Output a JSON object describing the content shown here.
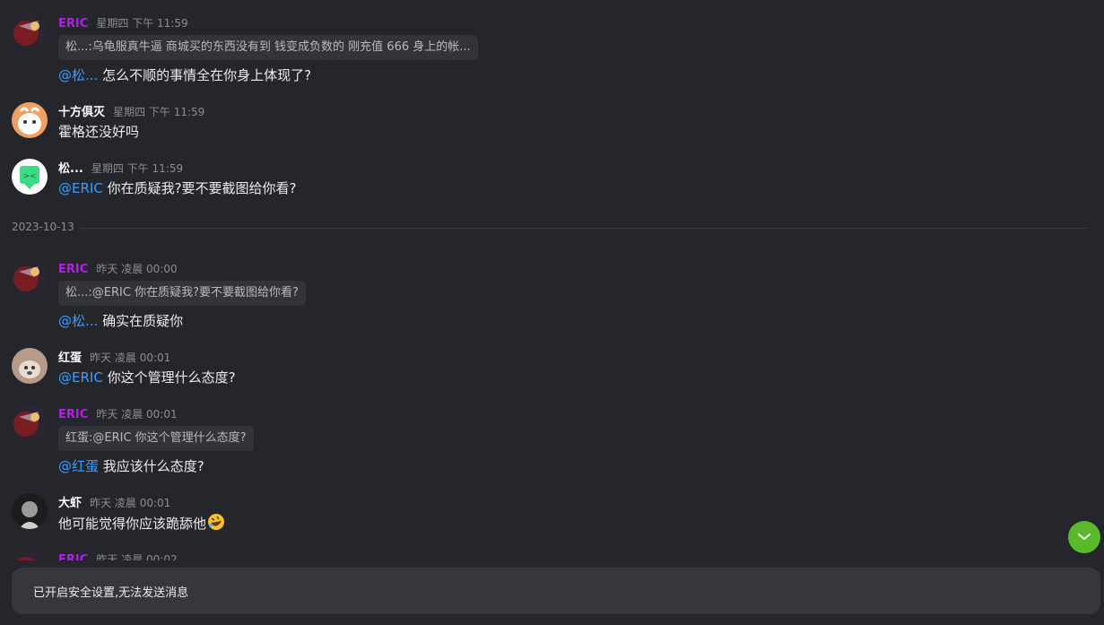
{
  "messages": [
    {
      "name": "ERIC",
      "time": "星期四 下午 11:59",
      "quote": "松...:乌龟服真牛逼 商城买的东西没有到 钱变成负数的 刚充值 666 身上的帐...",
      "mention": "@松...",
      "text": "怎么不顺的事情全在你身上体现了?"
    },
    {
      "name": "十方俱灭",
      "time": "星期四 下午 11:59",
      "text": "霍格还没好吗"
    },
    {
      "name": "松...",
      "time": "星期四 下午 11:59",
      "mention": "@ERIC",
      "text": "你在质疑我?要不要截图给你看?"
    },
    {
      "name": "ERIC",
      "time": "昨天 凌晨 00:00",
      "quote": "松...:@ERIC 你在质疑我?要不要截图给你看?",
      "mention": "@松...",
      "text": "确实在质疑你"
    },
    {
      "name": "红蛋",
      "time": "昨天 凌晨 00:01",
      "mention": "@ERIC",
      "text": "你这个管理什么态度?"
    },
    {
      "name": "ERIC",
      "time": "昨天 凌晨 00:01",
      "quote": "红蛋:@ERIC 你这个管理什么态度?",
      "mention": "@红蛋",
      "text": "我应该什么态度?"
    },
    {
      "name": "大虾",
      "time": "昨天 凌晨 00:01",
      "text": "他可能觉得你应该跪舔他",
      "emoji": "rolling-on-floor-laughing-emoji"
    },
    {
      "name": "ERIC",
      "time": "昨天 凌晨 00:02"
    }
  ],
  "date_divider": "2023-10-13",
  "input_bar": {
    "text": "已开启安全设置,无法发送消息"
  },
  "scroll_button": {
    "icon": "chevron-down-icon"
  },
  "colors": {
    "background": "#25262b",
    "mention": "#3b9cff",
    "eric_name": "#b020e6",
    "scroll_button": "#5ab92a"
  }
}
